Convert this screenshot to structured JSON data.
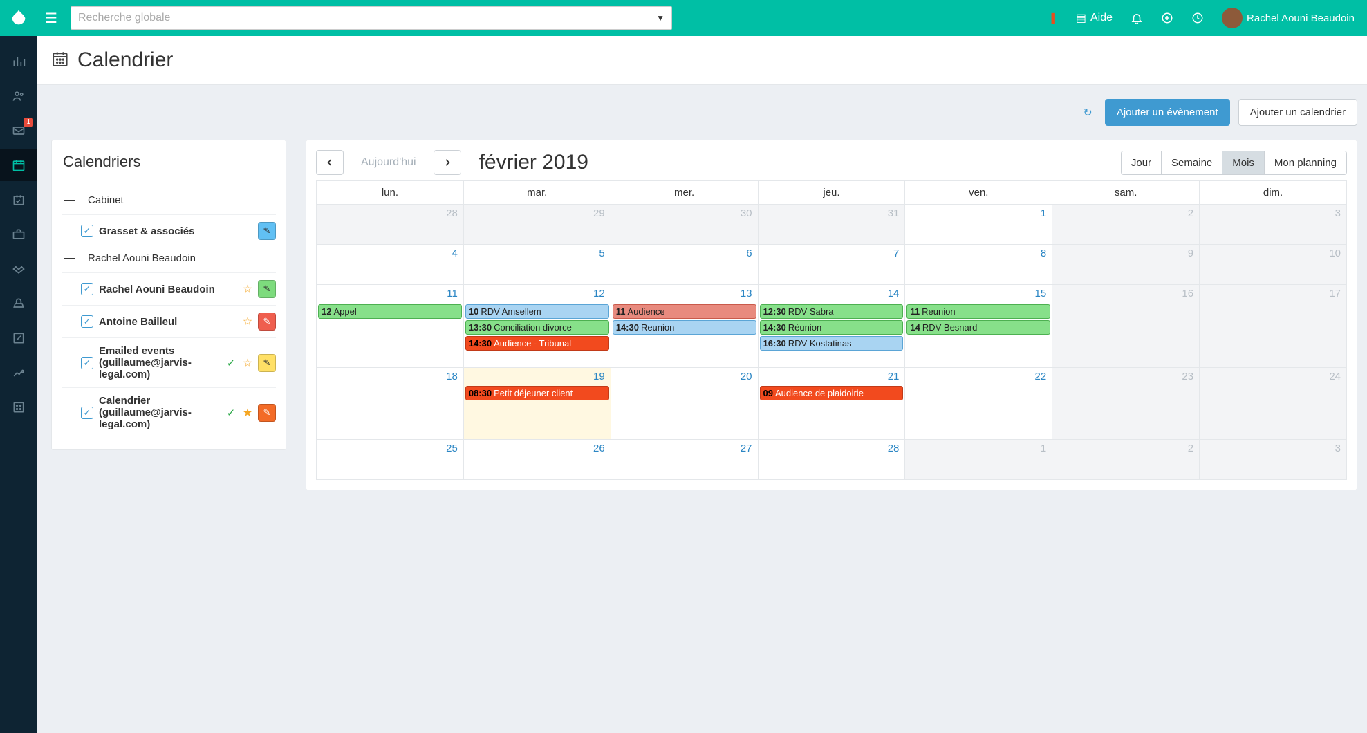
{
  "topbar": {
    "search_placeholder": "Recherche globale",
    "help_label": "Aide",
    "user_name": "Rachel Aouni Beaudoin"
  },
  "leftRail": {
    "mail_badge": "1"
  },
  "page": {
    "title": "Calendrier",
    "btn_add_event": "Ajouter un évènement",
    "btn_add_calendar": "Ajouter un calendrier"
  },
  "sidebar": {
    "heading": "Calendriers",
    "groups": [
      {
        "label": "Cabinet",
        "items": [
          {
            "label": "Grasset & associés",
            "edit_class": "eb-blue"
          }
        ]
      },
      {
        "label": "Rachel Aouni Beaudoin",
        "items": [
          {
            "label": "Rachel Aouni Beaudoin",
            "star": "outline",
            "edit_class": "eb-green"
          },
          {
            "label": "Antoine Bailleul",
            "star": "outline",
            "edit_class": "eb-red"
          },
          {
            "label": "Emailed events (guillaume@jarvis-legal.com)",
            "check": true,
            "star": "outline",
            "edit_class": "eb-yellow"
          },
          {
            "label": "Calendrier (guillaume@jarvis-legal.com)",
            "check": true,
            "star": "solid",
            "edit_class": "eb-orange"
          }
        ]
      }
    ]
  },
  "calendar": {
    "today_label": "Aujourd'hui",
    "month_title": "février 2019",
    "views": {
      "day": "Jour",
      "week": "Semaine",
      "month": "Mois",
      "plan": "Mon planning"
    },
    "day_headers": [
      "lun.",
      "mar.",
      "mer.",
      "jeu.",
      "ven.",
      "sam.",
      "dim."
    ],
    "weeks": [
      [
        {
          "n": "28",
          "other": true
        },
        {
          "n": "29",
          "other": true
        },
        {
          "n": "30",
          "other": true
        },
        {
          "n": "31",
          "other": true
        },
        {
          "n": "1"
        },
        {
          "n": "2",
          "other": true
        },
        {
          "n": "3",
          "other": true
        }
      ],
      [
        {
          "n": "4"
        },
        {
          "n": "5"
        },
        {
          "n": "6"
        },
        {
          "n": "7"
        },
        {
          "n": "8"
        },
        {
          "n": "9",
          "other": true
        },
        {
          "n": "10",
          "other": true
        }
      ],
      [
        {
          "n": "11",
          "events": [
            {
              "t": "12",
              "label": "Appel",
              "c": "ev-green"
            }
          ]
        },
        {
          "n": "12",
          "events": [
            {
              "t": "10",
              "label": "RDV Amsellem",
              "c": "ev-blue"
            },
            {
              "t": "13:30",
              "label": "Conciliation divorce",
              "c": "ev-green"
            },
            {
              "t": "14:30",
              "label": "Audience - Tribunal",
              "c": "ev-red"
            }
          ]
        },
        {
          "n": "13",
          "events": [
            {
              "t": "11",
              "label": "Audience",
              "c": "ev-redsoft"
            },
            {
              "t": "14:30",
              "label": "Reunion",
              "c": "ev-blue"
            }
          ]
        },
        {
          "n": "14",
          "events": [
            {
              "t": "12:30",
              "label": "RDV Sabra",
              "c": "ev-green"
            },
            {
              "t": "14:30",
              "label": "Réunion",
              "c": "ev-green"
            },
            {
              "t": "16:30",
              "label": "RDV Kostatinas",
              "c": "ev-blue"
            }
          ]
        },
        {
          "n": "15",
          "events": [
            {
              "t": "11",
              "label": "Reunion",
              "c": "ev-green"
            },
            {
              "t": "14",
              "label": "RDV Besnard",
              "c": "ev-green"
            }
          ]
        },
        {
          "n": "16",
          "other": true
        },
        {
          "n": "17",
          "other": true
        }
      ],
      [
        {
          "n": "18"
        },
        {
          "n": "19",
          "today": true,
          "events": [
            {
              "t": "08:30",
              "label": "Petit déjeuner client",
              "c": "ev-red"
            }
          ]
        },
        {
          "n": "20"
        },
        {
          "n": "21",
          "events": [
            {
              "t": "09",
              "label": "Audience de plaidoirie",
              "c": "ev-red"
            }
          ]
        },
        {
          "n": "22"
        },
        {
          "n": "23",
          "other": true
        },
        {
          "n": "24",
          "other": true
        }
      ],
      [
        {
          "n": "25"
        },
        {
          "n": "26"
        },
        {
          "n": "27"
        },
        {
          "n": "28"
        },
        {
          "n": "1",
          "other": true
        },
        {
          "n": "2",
          "other": true
        },
        {
          "n": "3",
          "other": true
        }
      ]
    ]
  }
}
